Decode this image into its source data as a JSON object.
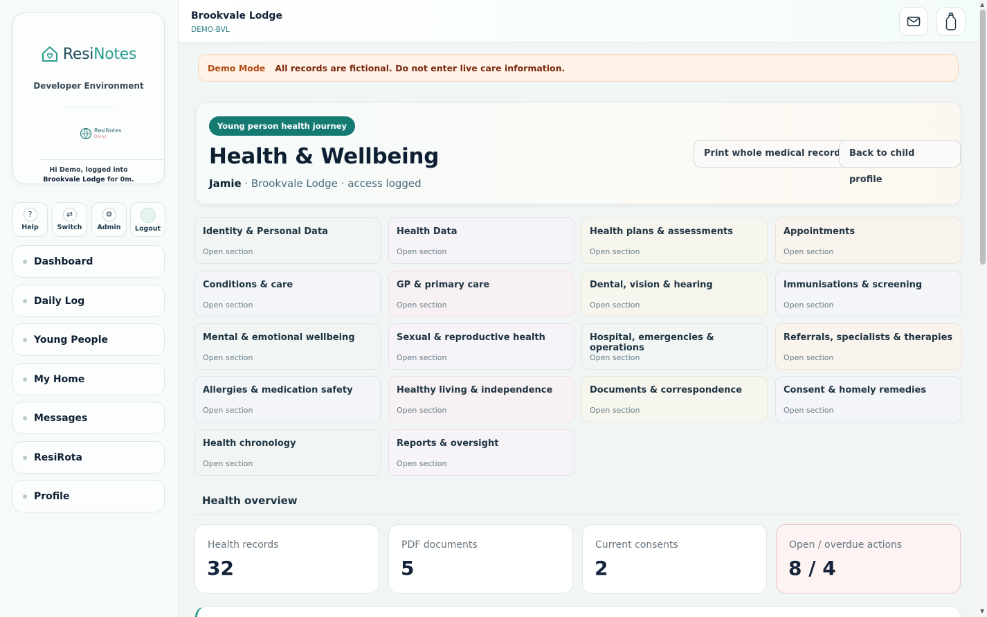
{
  "sidebar": {
    "brand": {
      "resi": "Resi",
      "notes": "Notes"
    },
    "environment": "Developer Environment",
    "mini_logo": {
      "name": "ResiNotes",
      "tag": "Demo"
    },
    "greeting": {
      "prefix": "Hi Demo, logged into ",
      "home": "Brookvale Lodge",
      "suffix": " for 0m."
    },
    "quick_actions": [
      {
        "label": "Help",
        "icon": "?"
      },
      {
        "label": "Switch",
        "icon": "⇄"
      },
      {
        "label": "Admin",
        "icon": "⚙"
      },
      {
        "label": "Logout",
        "icon": ""
      }
    ],
    "nav": [
      "Dashboard",
      "Daily Log",
      "Young People",
      "My Home",
      "Messages",
      "ResiRota",
      "Profile"
    ]
  },
  "header": {
    "home_name": "Brookvale Lodge",
    "home_code": "DEMO-BVL",
    "icons": [
      "mail-icon",
      "notification-bottle-icon"
    ]
  },
  "banner": {
    "label": "Demo Mode",
    "text": "All records are fictional. Do not enter live care information."
  },
  "hero": {
    "pill": "Young person health journey",
    "title": "Health & Wellbeing",
    "child": "Jamie",
    "sub": " · Brookvale Lodge · access logged",
    "print_button": "Print whole medical record",
    "back_button": "Back to child profile"
  },
  "sections": [
    {
      "title": "Identity & Personal Data",
      "link": "Open section"
    },
    {
      "title": "Health Data",
      "link": "Open section"
    },
    {
      "title": "Health plans & assessments",
      "link": "Open section"
    },
    {
      "title": "Appointments",
      "link": "Open section"
    },
    {
      "title": "Conditions & care",
      "link": "Open section"
    },
    {
      "title": "GP & primary care",
      "link": "Open section"
    },
    {
      "title": "Dental, vision & hearing",
      "link": "Open section"
    },
    {
      "title": "Immunisations & screening",
      "link": "Open section"
    },
    {
      "title": "Mental & emotional wellbeing",
      "link": "Open section"
    },
    {
      "title": "Sexual & reproductive health",
      "link": "Open section"
    },
    {
      "title": "Hospital, emergencies & operations",
      "link": "Open section"
    },
    {
      "title": "Referrals, specialists & therapies",
      "link": "Open section"
    },
    {
      "title": "Allergies & medication safety",
      "link": "Open section"
    },
    {
      "title": "Healthy living & independence",
      "link": "Open section"
    },
    {
      "title": "Documents & correspondence",
      "link": "Open section"
    },
    {
      "title": "Consent & homely remedies",
      "link": "Open section"
    },
    {
      "title": "Health chronology",
      "link": "Open section"
    },
    {
      "title": "Reports & oversight",
      "link": "Open section"
    }
  ],
  "overview": {
    "title": "Health overview",
    "stats": [
      {
        "label": "Health records",
        "value": "32"
      },
      {
        "label": "PDF documents",
        "value": "5"
      },
      {
        "label": "Current consents",
        "value": "2"
      },
      {
        "label": "Open / overdue actions",
        "value": "8 / 4"
      }
    ]
  }
}
